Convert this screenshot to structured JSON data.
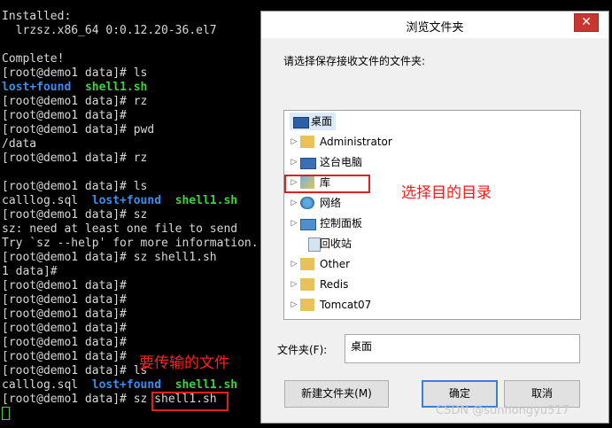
{
  "terminal": {
    "lines": [
      [
        {
          "t": "Installed:"
        }
      ],
      [
        {
          "t": "  lrzsz.x86_64 0:0.12.20-36.el7"
        }
      ],
      [
        {
          "t": ""
        }
      ],
      [
        {
          "t": "Complete!"
        }
      ],
      [
        {
          "t": "[root@demo1 data]# ls"
        }
      ],
      [
        {
          "t": "lost+found",
          "c": "cyan"
        },
        {
          "t": "  "
        },
        {
          "t": "shell1.sh",
          "c": "green"
        }
      ],
      [
        {
          "t": "[root@demo1 data]# rz"
        }
      ],
      [
        {
          "t": "[root@demo1 data]#"
        }
      ],
      [
        {
          "t": "[root@demo1 data]# pwd"
        }
      ],
      [
        {
          "t": "/data"
        }
      ],
      [
        {
          "t": "[root@demo1 data]# rz"
        }
      ],
      [
        {
          "t": ""
        }
      ],
      [
        {
          "t": "[root@demo1 data]# ls"
        }
      ],
      [
        {
          "t": "calllog.sql  "
        },
        {
          "t": "lost+found",
          "c": "cyan"
        },
        {
          "t": "  "
        },
        {
          "t": "shell1.sh",
          "c": "green"
        }
      ],
      [
        {
          "t": "[root@demo1 data]# sz"
        }
      ],
      [
        {
          "t": "sz: need at least one file to send"
        }
      ],
      [
        {
          "t": "Try `sz --help' for more information."
        }
      ],
      [
        {
          "t": "[root@demo1 data]# sz shell1.sh"
        }
      ],
      [
        {
          "t": "1 data]#"
        }
      ],
      [
        {
          "t": "[root@demo1 data]#"
        }
      ],
      [
        {
          "t": "[root@demo1 data]#"
        }
      ],
      [
        {
          "t": "[root@demo1 data]#"
        }
      ],
      [
        {
          "t": "[root@demo1 data]#"
        }
      ],
      [
        {
          "t": "[root@demo1 data]#"
        }
      ],
      [
        {
          "t": "[root@demo1 data]#"
        }
      ],
      [
        {
          "t": "[root@demo1 data]# ls"
        }
      ],
      [
        {
          "t": "calllog.sql  "
        },
        {
          "t": "lost+found",
          "c": "cyan"
        },
        {
          "t": "  "
        },
        {
          "t": "shell1.sh",
          "c": "green"
        }
      ],
      [
        {
          "t": "[root@demo1 data]# sz shell1.sh"
        }
      ]
    ],
    "annotation_file": "要传输的文件"
  },
  "dialog": {
    "title": "浏览文件夹",
    "close_glyph": "✕",
    "prompt": "请选择保存接收文件的文件夹:",
    "tree": [
      {
        "label": "桌面",
        "icon": "desktop-icon",
        "expandable": false,
        "selected": true
      },
      {
        "label": "Administrator",
        "icon": "user-folder-icon",
        "expandable": true
      },
      {
        "label": "这台电脑",
        "icon": "computer-icon",
        "expandable": true
      },
      {
        "label": "库",
        "icon": "library-icon",
        "expandable": true
      },
      {
        "label": "网络",
        "icon": "network-icon",
        "expandable": true
      },
      {
        "label": "控制面板",
        "icon": "control-panel-icon",
        "expandable": true
      },
      {
        "label": "回收站",
        "icon": "recycle-bin-icon",
        "expandable": false
      },
      {
        "label": "Other",
        "icon": "folder-icon",
        "expandable": true
      },
      {
        "label": "Redis",
        "icon": "folder-icon",
        "expandable": true
      },
      {
        "label": "Tomcat07",
        "icon": "folder-icon",
        "expandable": true
      }
    ],
    "folder_label": "文件夹(F):",
    "folder_value": "桌面",
    "buttons": {
      "new_folder": "新建文件夹(M)",
      "ok": "确定",
      "cancel": "取消"
    },
    "annotation_dir": "选择目的目录"
  },
  "watermark": "CSDN @sunhongyu517"
}
